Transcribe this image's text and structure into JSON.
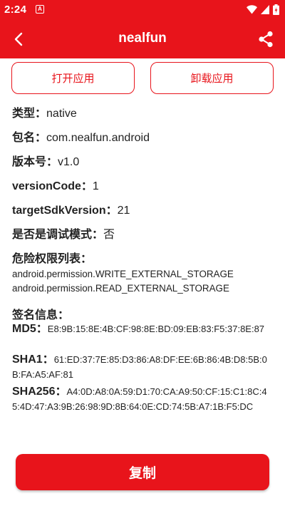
{
  "status_bar": {
    "time": "2:24",
    "notification_glyph": "A"
  },
  "app_bar": {
    "title": "nealfun"
  },
  "actions": {
    "open_label": "打开应用",
    "uninstall_label": "卸载应用"
  },
  "info": {
    "type_key": "类型：",
    "type_value": "native",
    "package_key": "包名：",
    "package_value": "com.nealfun.android",
    "version_key": "版本号：",
    "version_value": "v1.0",
    "version_code_key": "versionCode：",
    "version_code_value": "1",
    "target_sdk_key": "targetSdkVersion：",
    "target_sdk_value": "21",
    "debug_key": "是否是调试模式：",
    "debug_value": "否",
    "perms_key": "危险权限列表："
  },
  "permissions": [
    "android.permission.WRITE_EXTERNAL_STORAGE",
    "android.permission.READ_EXTERNAL_STORAGE"
  ],
  "signature": {
    "title": "签名信息：",
    "md5_key": "MD5：",
    "md5_value": "E8:9B:15:8E:4B:CF:98:8E:BD:09:EB:83:F5:37:8E:87",
    "sha1_key": "SHA1：",
    "sha1_value": "61:ED:37:7E:85:D3:86:A8:DF:EE:6B:86:4B:D8:5B:0B:FA:A5:AF:81",
    "sha256_key": "SHA256：",
    "sha256_value": "A4:0D:A8:0A:59:D1:70:CA:A9:50:CF:15:C1:8C:45:4D:47:A3:9B:26:98:9D:8B:64:0E:CD:74:5B:A7:1B:F5:DC"
  },
  "copy_button": {
    "label": "复制"
  },
  "colors": {
    "accent": "#e8141b",
    "text": "#222222",
    "background": "#ffffff"
  },
  "icons": [
    "notification-icon",
    "wifi-icon",
    "signal-icon",
    "battery-icon",
    "back-arrow-icon",
    "share-icon"
  ]
}
